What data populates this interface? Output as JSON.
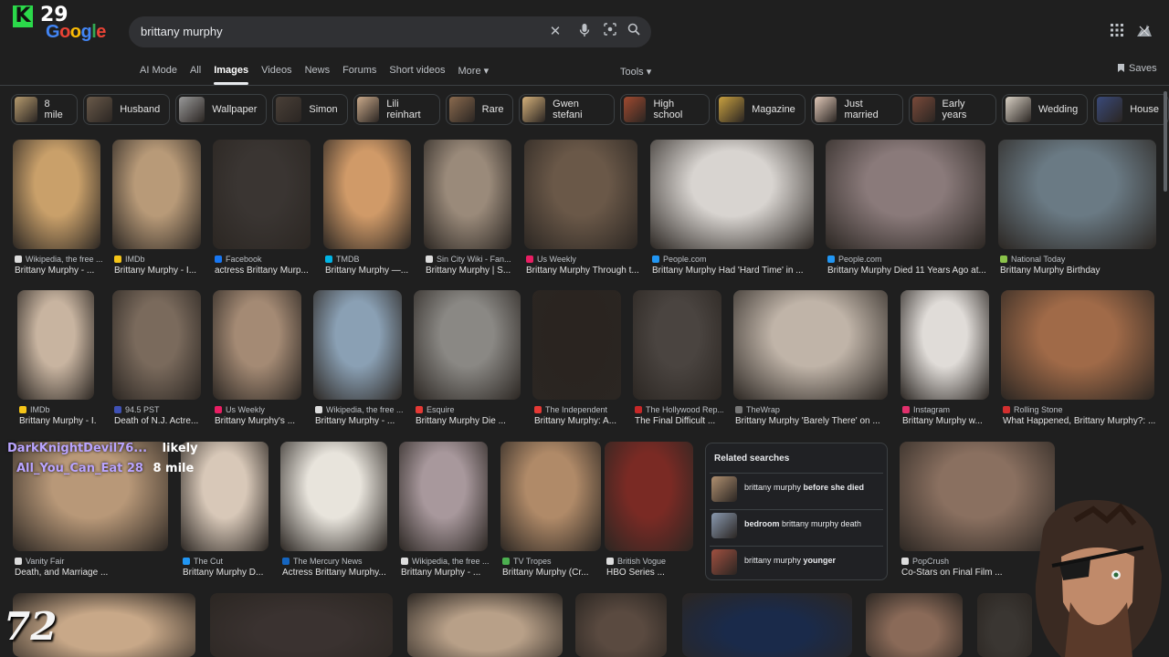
{
  "logo": {
    "badge": "K",
    "number": "29",
    "google": [
      "G",
      "o",
      "o",
      "g",
      "l",
      "e"
    ]
  },
  "search": {
    "query": "brittany murphy"
  },
  "tabs": [
    {
      "label": "AI Mode"
    },
    {
      "label": "All"
    },
    {
      "label": "Images"
    },
    {
      "label": "Videos"
    },
    {
      "label": "News"
    },
    {
      "label": "Forums"
    },
    {
      "label": "Short videos"
    },
    {
      "label": "More ▾"
    }
  ],
  "tools_label": "Tools ▾",
  "saves_label": "Saves",
  "chips": [
    {
      "label": "8 mile",
      "color": "#b59a6e"
    },
    {
      "label": "Husband",
      "color": "#6a5a4a"
    },
    {
      "label": "Wallpaper",
      "color": "#999"
    },
    {
      "label": "Simon",
      "color": "#4a4038"
    },
    {
      "label": "Lili reinhart",
      "color": "#c9a98a"
    },
    {
      "label": "Rare",
      "color": "#8a6a4e"
    },
    {
      "label": "Gwen stefani",
      "color": "#d4b07a"
    },
    {
      "label": "High school",
      "color": "#a04a30"
    },
    {
      "label": "Magazine",
      "color": "#c8a040"
    },
    {
      "label": "Just married",
      "color": "#e0c8b8"
    },
    {
      "label": "Early years",
      "color": "#7a4a3a"
    },
    {
      "label": "Wedding",
      "color": "#d8d0c4"
    },
    {
      "label": "House",
      "color": "#3a4a7a"
    }
  ],
  "row1": [
    {
      "src": "Wikipedia, the free ...",
      "title": "Brittany Murphy - ...",
      "fav": "#ddd",
      "bg": "#c9a06a"
    },
    {
      "src": "IMDb",
      "title": "Brittany Murphy - I...",
      "fav": "#f5c518",
      "bg": "#b89a78"
    },
    {
      "src": "Facebook",
      "title": "actress Brittany Murp...",
      "fav": "#1877f2",
      "bg": "#3a3532"
    },
    {
      "src": "TMDB",
      "title": "Brittany Murphy —...",
      "fav": "#01b4e4",
      "bg": "#d09a68"
    },
    {
      "src": "Sin City Wiki - Fan...",
      "title": "Brittany Murphy | S...",
      "fav": "#ddd",
      "bg": "#9a8a7a"
    },
    {
      "src": "Us Weekly",
      "title": "Brittany Murphy Through t...",
      "fav": "#e91e63",
      "bg": "#6a5848"
    },
    {
      "src": "People.com",
      "title": "Brittany Murphy Had 'Hard Time' in ...",
      "fav": "#2196f3",
      "bg": "#d8d4d0"
    },
    {
      "src": "People.com",
      "title": "Brittany Murphy Died 11 Years Ago at...",
      "fav": "#2196f3",
      "bg": "#8a7a7a"
    },
    {
      "src": "National Today",
      "title": "Brittany Murphy Birthday",
      "fav": "#8bc34a",
      "bg": "#6a7a84"
    }
  ],
  "row2": [
    {
      "src": "IMDb",
      "title": "Brittany Murphy - I...",
      "fav": "#f5c518",
      "bg": "#c8b4a0"
    },
    {
      "src": "94.5 PST",
      "title": "Death of N.J. Actre...",
      "fav": "#3f51b5",
      "bg": "#7a6a5c"
    },
    {
      "src": "Us Weekly",
      "title": "Brittany Murphy's ...",
      "fav": "#e91e63",
      "bg": "#a48a74"
    },
    {
      "src": "Wikipedia, the free ...",
      "title": "Brittany Murphy - ...",
      "fav": "#ddd",
      "bg": "#8aa0b4"
    },
    {
      "src": "Esquire",
      "title": "Brittany Murphy Die ...",
      "fav": "#e53935",
      "bg": "#8a8884"
    },
    {
      "src": "The Independent",
      "title": "Brittany Murphy: A...",
      "fav": "#e53935",
      "bg": "#2a2420"
    },
    {
      "src": "The Hollywood Rep...",
      "title": "The Final Difficult ...",
      "fav": "#c62828",
      "bg": "#4a4440"
    },
    {
      "src": "TheWrap",
      "title": "Brittany Murphy 'Barely There' on ...",
      "fav": "#777",
      "bg": "#c0b4a8"
    },
    {
      "src": "Instagram",
      "title": "Brittany Murphy w...",
      "fav": "#e1306c",
      "bg": "#e0dcd8"
    },
    {
      "src": "Rolling Stone",
      "title": "What Happened, Brittany Murphy?: ...",
      "fav": "#d32f2f",
      "bg": "#a06a48"
    }
  ],
  "row3": [
    {
      "src": "Vanity Fair",
      "title": "Death, and Marriage ...",
      "fav": "#ddd",
      "bg": "#b89878"
    },
    {
      "src": "The Cut",
      "title": "Brittany Murphy D...",
      "fav": "#2196f3",
      "bg": "#d8c8b8"
    },
    {
      "src": "The Mercury News",
      "title": "Actress Brittany Murphy...",
      "fav": "#1565c0",
      "bg": "#e8e4dc"
    },
    {
      "src": "Wikipedia, the free ...",
      "title": "Brittany Murphy - ...",
      "fav": "#ddd",
      "bg": "#a8989c"
    },
    {
      "src": "TV Tropes",
      "title": "Brittany Murphy (Cr...",
      "fav": "#4caf50",
      "bg": "#b08a68"
    },
    {
      "src": "British Vogue",
      "title": "HBO Series ...",
      "fav": "#ddd",
      "bg": "#7a2a24"
    },
    {
      "src": "PopCrush",
      "title": "Co-Stars on Final Film ...",
      "fav": "#ddd",
      "bg": "#8a7060"
    }
  ],
  "related": {
    "heading": "Related searches",
    "items": [
      {
        "pre": "brittany murphy ",
        "bold": "before she died",
        "post": "",
        "color": "#b09070"
      },
      {
        "pre": "",
        "bold": "bedroom",
        "post": " brittany murphy death",
        "color": "#8a9ab0"
      },
      {
        "pre": "brittany murphy ",
        "bold": "younger",
        "post": "",
        "color": "#a05040"
      }
    ]
  },
  "overlay": {
    "chat1_name": "DarkKnightDevil76...",
    "chat1_msg": "likely",
    "chat2_name": "All_You_Can_Eat 28",
    "chat2_msg": "8 mile",
    "watermark": "72"
  }
}
